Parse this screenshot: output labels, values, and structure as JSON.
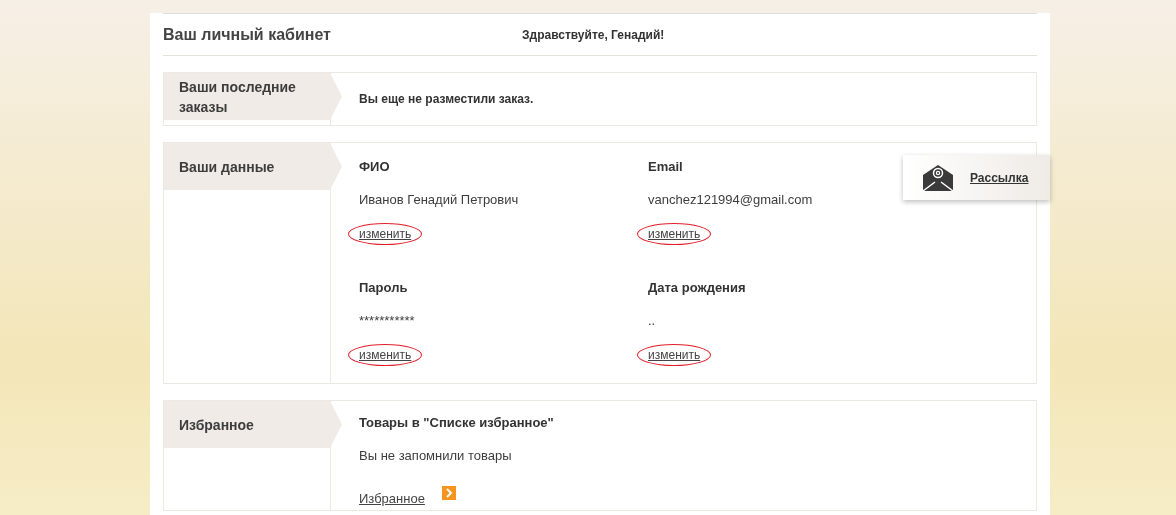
{
  "header": {
    "title": "Ваш личный кабинет",
    "greeting": "Здравствуйте, Генадий!"
  },
  "orders": {
    "label": "Ваши последние заказы",
    "message": "Вы еще не разместили заказ."
  },
  "profile": {
    "label": "Ваши данные",
    "fields": [
      {
        "label": "ФИО",
        "value": "Иванов Генадий Петрович",
        "action": "изменить",
        "circled": true
      },
      {
        "label": "Email",
        "value": "vanchez121994@gmail.com",
        "action": "изменить",
        "circled": true
      },
      {
        "label": "Пароль",
        "value": "***********",
        "action": "изменить",
        "circled": true
      },
      {
        "label": "Дата рождения",
        "value": "..",
        "action": "изменить",
        "circled": true
      }
    ]
  },
  "favorites": {
    "label": "Избранное",
    "heading": "Товары в \"Списке избранное\"",
    "message": "Вы не запомнили товары",
    "link": "Избранное"
  },
  "newsletter": {
    "label": "Рассылка"
  }
}
